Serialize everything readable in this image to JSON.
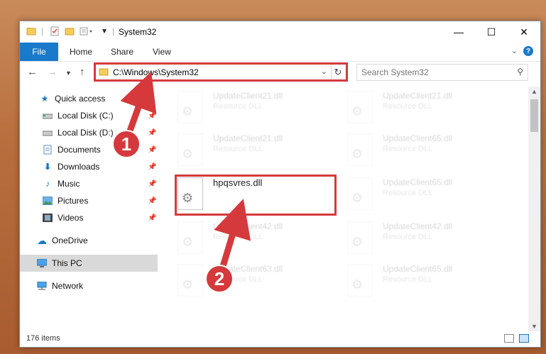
{
  "window": {
    "title": "System32",
    "minimize": "—",
    "maximize": "☐",
    "close": "✕"
  },
  "ribbon": {
    "file": "File",
    "home": "Home",
    "share": "Share",
    "view": "View",
    "help": "?"
  },
  "nav": {
    "address": "C:\\Windows\\System32",
    "search_placeholder": "Search System32"
  },
  "sidebar": {
    "items": [
      {
        "label": "Quick access",
        "icon": "star-icon"
      },
      {
        "label": "Local Disk (C:)",
        "icon": "drive-icon"
      },
      {
        "label": "Local Disk (D:)",
        "icon": "drive-icon"
      },
      {
        "label": "Documents",
        "icon": "documents-icon"
      },
      {
        "label": "Downloads",
        "icon": "download-icon"
      },
      {
        "label": "Music",
        "icon": "music-icon"
      },
      {
        "label": "Pictures",
        "icon": "pictures-icon"
      },
      {
        "label": "Videos",
        "icon": "videos-icon"
      },
      {
        "label": "OneDrive",
        "icon": "cloud-icon"
      },
      {
        "label": "This PC",
        "icon": "computer-icon"
      },
      {
        "label": "Network",
        "icon": "network-icon"
      }
    ]
  },
  "files": {
    "left": [
      {
        "name": "UpdateClient21.dll",
        "type": "Resource DLL"
      },
      {
        "name": "UpdateClient21.dll",
        "type": "Resource DLL"
      },
      {
        "name": "hpqsvres.dll",
        "type": ""
      },
      {
        "name": "UpdateClient42.dll",
        "type": "Resource DLL"
      },
      {
        "name": "UpdateClient63.dll",
        "type": "Resource DLL"
      }
    ],
    "right": [
      {
        "name": "UpdateClient21.dll",
        "type": "Resource DLL"
      },
      {
        "name": "UpdateClient65.dll",
        "type": "Resource DLL"
      },
      {
        "name": "UpdateClient65.dll",
        "type": "Resource DLL"
      },
      {
        "name": "UpdateClient42.dll",
        "type": "Resource DLL"
      },
      {
        "name": "UpdateClient65.dll",
        "type": "Resource DLL"
      }
    ]
  },
  "status": {
    "count": "176 items"
  },
  "annotations": {
    "step1": "1",
    "step2": "2",
    "highlight_color": "#d5393c"
  }
}
